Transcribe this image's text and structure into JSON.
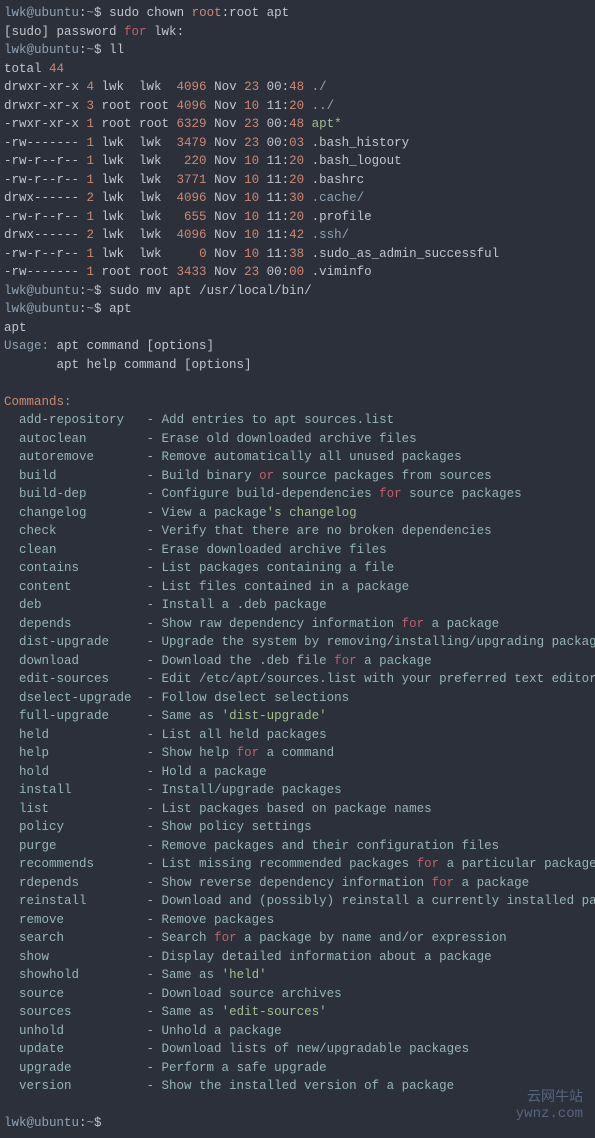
{
  "prompt": {
    "user": "lwk",
    "at": "@",
    "host": "ubuntu",
    "colon": ":",
    "tilde": "~",
    "dollar": "$"
  },
  "lines": {
    "l1_cmd": " sudo chown ",
    "l1_root": "root",
    "l1_root2": ":root apt",
    "l2a": "[sudo] password ",
    "l2_for": "for",
    "l2b": " lwk",
    "l2c": ":",
    "l3_cmd": " ll",
    "l4": "total ",
    "l4_n": "44",
    "ll": [
      {
        "perm": "drwxr-xr-x ",
        "n": "4",
        "own": " lwk  lwk  ",
        "size": "4096",
        "mon": " Nov ",
        "day": "23",
        "time": " 00",
        ":": ":",
        "mm": "48",
        "rest": " ./",
        "dir": true
      },
      {
        "perm": "drwxr-xr-x ",
        "n": "3",
        "own": " root root ",
        "size": "4096",
        "mon": " Nov ",
        "day": "10",
        "time": " 11",
        ":": ":",
        "mm": "20",
        "rest": " ../",
        "dir": true
      },
      {
        "perm": "-rwxr-xr-x ",
        "n": "1",
        "own": " root root ",
        "size": "6329",
        "mon": " Nov ",
        "day": "23",
        "time": " 00",
        ":": ":",
        "mm": "48",
        "rest": " apt*",
        "dir": false,
        "exec": true
      },
      {
        "perm": "-rw------- ",
        "n": "1",
        "own": " lwk  lwk  ",
        "size": "3479",
        "mon": " Nov ",
        "day": "23",
        "time": " 00",
        ":": ":",
        "mm": "03",
        "rest": " .bash_history",
        "dir": false
      },
      {
        "perm": "-rw-r--r-- ",
        "n": "1",
        "own": " lwk  lwk   ",
        "size": "220",
        "mon": " Nov ",
        "day": "10",
        "time": " 11",
        ":": ":",
        "mm": "20",
        "rest": " .bash_logout",
        "dir": false
      },
      {
        "perm": "-rw-r--r-- ",
        "n": "1",
        "own": " lwk  lwk  ",
        "size": "3771",
        "mon": " Nov ",
        "day": "10",
        "time": " 11",
        ":": ":",
        "mm": "20",
        "rest": " .bashrc",
        "dir": false
      },
      {
        "perm": "drwx------ ",
        "n": "2",
        "own": " lwk  lwk  ",
        "size": "4096",
        "mon": " Nov ",
        "day": "10",
        "time": " 11",
        ":": ":",
        "mm": "30",
        "rest": " .cache/",
        "dir": true
      },
      {
        "perm": "-rw-r--r-- ",
        "n": "1",
        "own": " lwk  lwk   ",
        "size": "655",
        "mon": " Nov ",
        "day": "10",
        "time": " 11",
        ":": ":",
        "mm": "20",
        "rest": " .profile",
        "dir": false
      },
      {
        "perm": "drwx------ ",
        "n": "2",
        "own": " lwk  lwk  ",
        "size": "4096",
        "mon": " Nov ",
        "day": "10",
        "time": " 11",
        ":": ":",
        "mm": "42",
        "rest": " .ssh/",
        "dir": true
      },
      {
        "perm": "-rw-r--r-- ",
        "n": "1",
        "own": " lwk  lwk     ",
        "size": "0",
        "mon": " Nov ",
        "day": "10",
        "time": " 11",
        ":": ":",
        "mm": "38",
        "rest": " .sudo_as_admin_successful",
        "dir": false
      },
      {
        "perm": "-rw------- ",
        "n": "1",
        "own": " root root ",
        "size": "3433",
        "mon": " Nov ",
        "day": "23",
        "time": " 00",
        ":": ":",
        "mm": "00",
        "rest": " .viminfo",
        "dir": false
      }
    ],
    "l_mv": " sudo mv apt /usr/local/bin/",
    "l_apt": " apt",
    "l_aptout": "apt",
    "usage_label": "Usage:",
    "usage1": " apt command [options]",
    "usage2": "       apt help command [options]",
    "commands_label": "Commands:",
    "cmds": [
      {
        "c": "add-repository",
        "pad": "   ",
        "d": "- Add entries to apt sources.list"
      },
      {
        "c": "autoclean",
        "pad": "        ",
        "d": "- Erase old downloaded archive files"
      },
      {
        "c": "autoremove",
        "pad": "       ",
        "d": "- Remove automatically all unused packages"
      },
      {
        "c": "build",
        "pad": "            ",
        "d": "- Build binary ",
        "or": "or",
        "d2": " source packages from sources"
      },
      {
        "c": "build-dep",
        "pad": "        ",
        "d": "- Configure build-dependencies ",
        "or": "for",
        "d2": " source packages"
      },
      {
        "c": "changelog",
        "pad": "        ",
        "d": "- View a package",
        "q": "'s changelog"
      },
      {
        "c": "check",
        "pad": "            ",
        "d": "- Verify that there are no broken dependencies"
      },
      {
        "c": "clean",
        "pad": "            ",
        "d": "- Erase downloaded archive files"
      },
      {
        "c": "contains",
        "pad": "         ",
        "d": "- List packages containing a file"
      },
      {
        "c": "content",
        "pad": "          ",
        "d": "- List files contained in a package"
      },
      {
        "c": "deb",
        "pad": "              ",
        "d": "- Install a .deb package"
      },
      {
        "c": "depends",
        "pad": "          ",
        "d": "- Show raw dependency information ",
        "or": "for",
        "d2": " a package"
      },
      {
        "c": "dist-upgrade",
        "pad": "     ",
        "d": "- Upgrade the system by removing/installing/upgrading packages"
      },
      {
        "c": "download",
        "pad": "         ",
        "d": "- Download the .deb file ",
        "or": "for",
        "d2": " a package"
      },
      {
        "c": "edit-sources",
        "pad": "     ",
        "d": "- Edit /etc/apt/sources.list with your preferred text editor"
      },
      {
        "c": "dselect-upgrade",
        "pad": "  ",
        "d": "- Follow dselect selections"
      },
      {
        "c": "full-upgrade",
        "pad": "     ",
        "d": "- Same as ",
        "q": "'dist-upgrade'"
      },
      {
        "c": "held",
        "pad": "             ",
        "d": "- List all held packages"
      },
      {
        "c": "help",
        "pad": "             ",
        "d": "- Show help ",
        "or": "for",
        "d2": " a command"
      },
      {
        "c": "hold",
        "pad": "             ",
        "d": "- Hold a package"
      },
      {
        "c": "install",
        "pad": "          ",
        "d": "- Install/upgrade packages"
      },
      {
        "c": "list",
        "pad": "             ",
        "d": "- List packages based on package names"
      },
      {
        "c": "policy",
        "pad": "           ",
        "d": "- Show policy settings"
      },
      {
        "c": "purge",
        "pad": "            ",
        "d": "- Remove packages and their configuration files"
      },
      {
        "c": "recommends",
        "pad": "       ",
        "d": "- List missing recommended packages ",
        "or": "for",
        "d2": " a particular package"
      },
      {
        "c": "rdepends",
        "pad": "         ",
        "d": "- Show reverse dependency information ",
        "or": "for",
        "d2": " a package"
      },
      {
        "c": "reinstall",
        "pad": "        ",
        "d": "- Download and (possibly) reinstall a currently installed package"
      },
      {
        "c": "remove",
        "pad": "           ",
        "d": "- Remove packages"
      },
      {
        "c": "search",
        "pad": "           ",
        "d": "- Search ",
        "or": "for",
        "d2": " a package by name and/or expression"
      },
      {
        "c": "show",
        "pad": "             ",
        "d": "- Display detailed information about a package"
      },
      {
        "c": "showhold",
        "pad": "         ",
        "d": "- Same as ",
        "q": "'held'"
      },
      {
        "c": "source",
        "pad": "           ",
        "d": "- Download source archives"
      },
      {
        "c": "sources",
        "pad": "          ",
        "d": "- Same as ",
        "q": "'edit-sources'"
      },
      {
        "c": "unhold",
        "pad": "           ",
        "d": "- Unhold a package"
      },
      {
        "c": "update",
        "pad": "           ",
        "d": "- Download lists of new/upgradable packages"
      },
      {
        "c": "upgrade",
        "pad": "          ",
        "d": "- Perform a safe upgrade"
      },
      {
        "c": "version",
        "pad": "          ",
        "d": "- Show the installed version of a package"
      }
    ]
  },
  "watermark": {
    "l1": "云网牛站",
    "l2": "ywnz.com"
  }
}
